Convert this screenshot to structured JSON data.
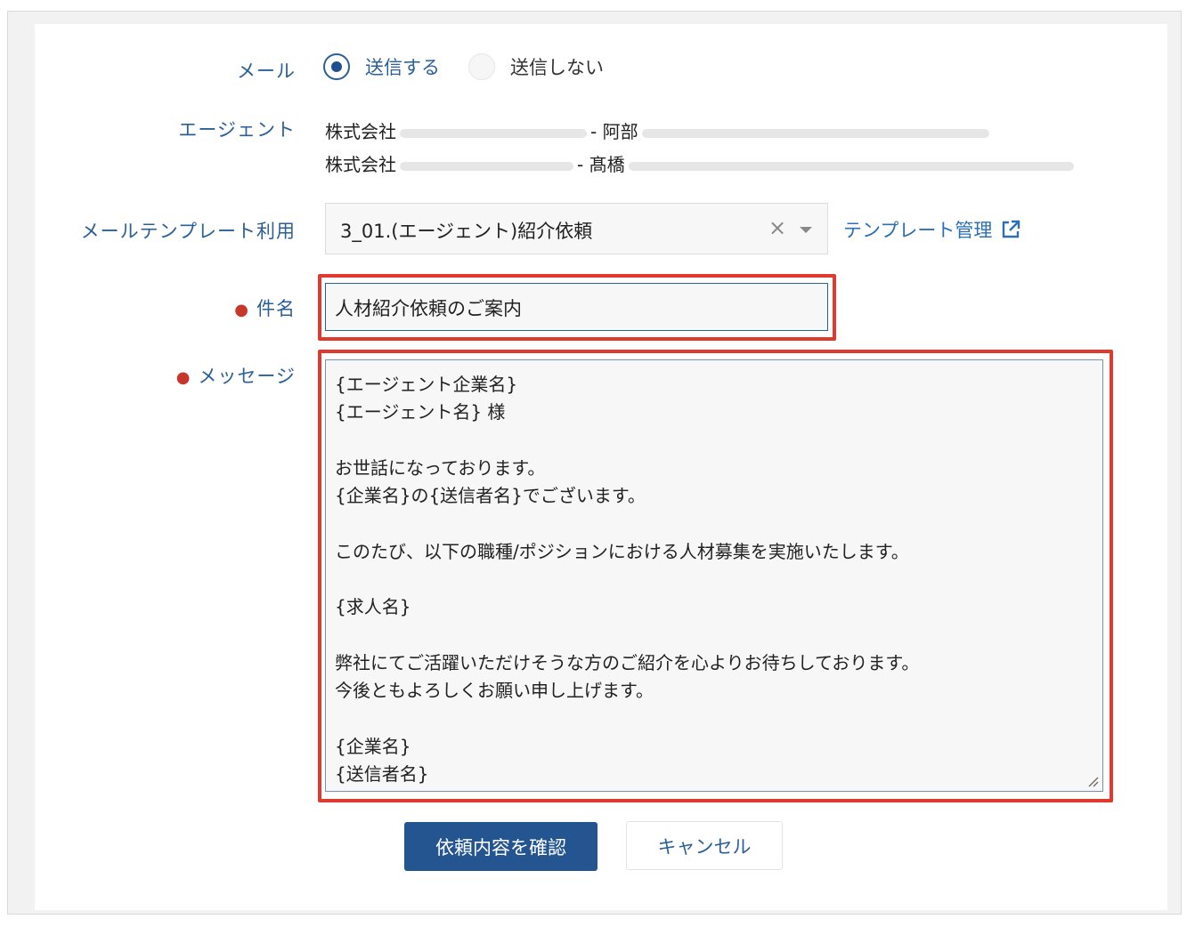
{
  "mail": {
    "label": "メール",
    "options": [
      {
        "label": "送信する",
        "selected": true
      },
      {
        "label": "送信しない",
        "selected": false
      }
    ]
  },
  "agent": {
    "label": "エージェント",
    "entries": [
      {
        "company": "株式会社",
        "separator": "- 阿部"
      },
      {
        "company": "株式会社",
        "separator": "- 髙橋"
      }
    ]
  },
  "template": {
    "label": "メールテンプレート利用",
    "value": "3_01.(エージェント)紹介依頼",
    "clear_icon": "×",
    "manage_link": "テンプレート管理"
  },
  "subject": {
    "label": "件名",
    "value": "人材紹介依頼のご案内"
  },
  "message": {
    "label": "メッセージ",
    "lines": [
      "{エージェント企業名}",
      "{エージェント名} 様",
      "",
      "お世話になっております。",
      "{企業名}の{送信者名}でございます。",
      "",
      "このたび、以下の職種/ポジションにおける人材募集を実施いたします。",
      "",
      "{求人名}",
      "",
      "弊社にてご活躍いただけそうな方のご紹介を心よりお待ちしております。",
      "今後ともよろしくお願い申し上げます。",
      "",
      "{企業名}",
      "{送信者名}"
    ]
  },
  "actions": {
    "confirm_label": "依頼内容を確認",
    "cancel_label": "キャンセル"
  },
  "colors": {
    "label_blue": "#2b5f97",
    "primary_button": "#245590",
    "required_dot": "#c8352b",
    "highlight_red": "#e03a2f"
  }
}
